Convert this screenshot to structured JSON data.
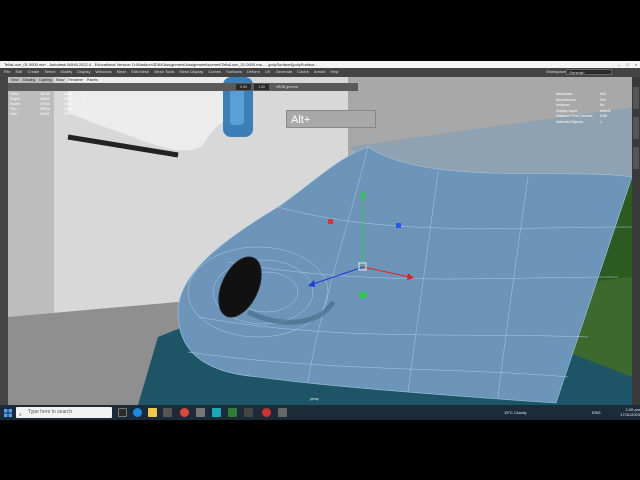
{
  "window": {
    "title": "TellaLoon_01.0000.ma* - Autodesk MAYA 2022.4 - Educational Version: D:\\Maddon\\3D64\\Assignment\\Assignment\\scenes\\TellaLoon_01.0000.ma --- |polySurface4|polySurface...",
    "controls": [
      "–",
      "□",
      "×"
    ]
  },
  "menubar": {
    "items": [
      "File",
      "Edit",
      "Create",
      "Select",
      "Modify",
      "Display",
      "Windows",
      "Mesh",
      "Edit Mesh",
      "Mesh Tools",
      "Mesh Display",
      "Curves",
      "Surfaces",
      "Deform",
      "UV",
      "Generate",
      "Cache",
      "Arnold",
      "Help"
    ],
    "workspace_label": "Workspace:",
    "workspace_value": "General*"
  },
  "panel": {
    "menu": [
      "View",
      "Shading",
      "Lighting",
      "Show",
      "Renderer",
      "Panels"
    ],
    "toolbar": {
      "field1": "0.00",
      "field2": "1.00",
      "colorspace": "sRGB gamma"
    },
    "hud_stats": [
      {
        "label": "Verts:",
        "c1": "48788",
        "c2": "4856",
        "c3": "0"
      },
      {
        "label": "Edges:",
        "c1": "96552",
        "c2": "9564",
        "c3": "0"
      },
      {
        "label": "Faces:",
        "c1": "47848",
        "c2": "4840",
        "c3": "0"
      },
      {
        "label": "Tris:",
        "c1": "95316",
        "c2": "9586",
        "c3": "0"
      },
      {
        "label": "UVs:",
        "c1": "50401",
        "c2": "5021",
        "c3": "0"
      }
    ],
    "hud_right": [
      {
        "label": "Backfaces:",
        "value": "N/A"
      },
      {
        "label": "Smoothness:",
        "value": "N/A"
      },
      {
        "label": "Instance:",
        "value": "No"
      },
      {
        "label": "Display Layer:",
        "value": "default"
      },
      {
        "label": "Distance From Camera:",
        "value": "9.88"
      },
      {
        "label": "Selected Objects:",
        "value": "1"
      }
    ],
    "overlay_text": "Alt+",
    "camera": "persp"
  },
  "taskbar": {
    "search_placeholder": "Type here to search",
    "weather": "15°C",
    "weather_desc": "Cloudy",
    "language": "ENG",
    "time": "2:26 pm",
    "date": "17/11/2023"
  },
  "colors": {
    "model_blue": "#6d95b9",
    "viewport_bg": "#a9a9a9",
    "maya_dark": "#444444",
    "taskbar": "#1c2b3a"
  }
}
